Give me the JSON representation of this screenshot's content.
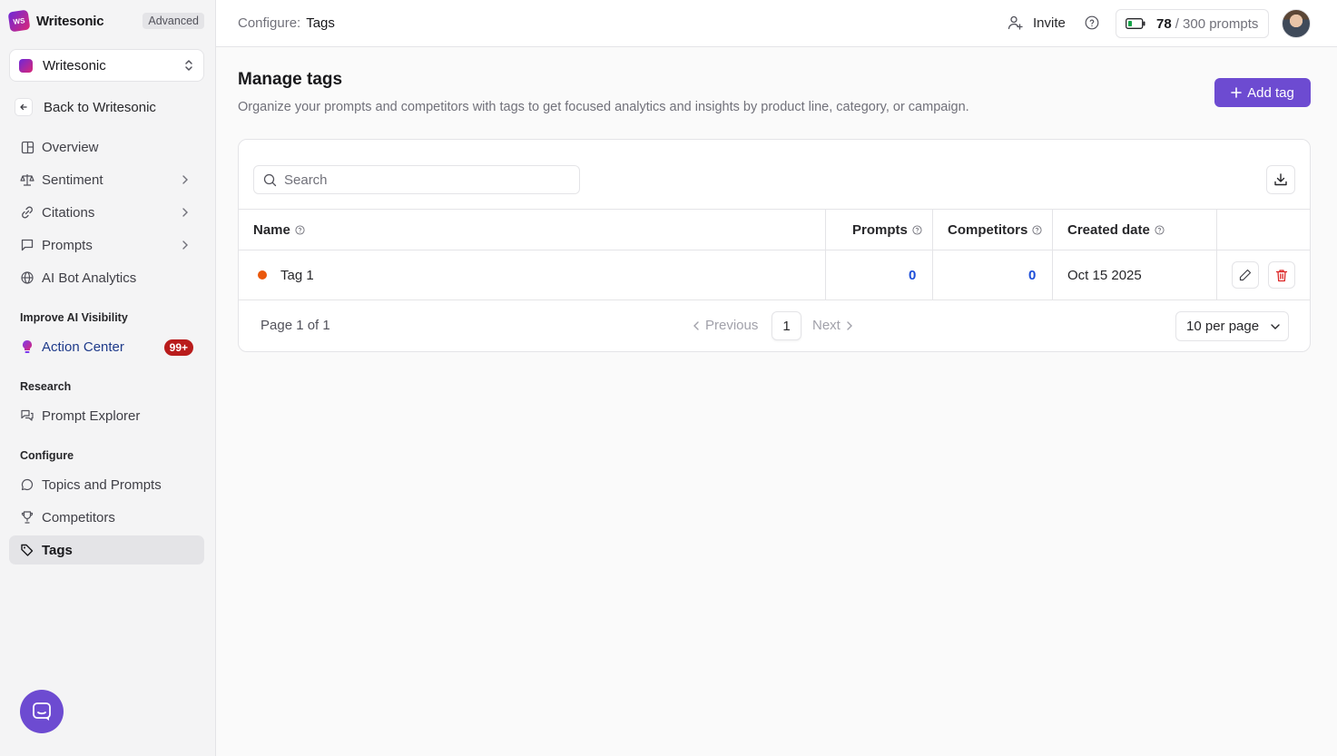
{
  "brand": {
    "logo_text": "WS",
    "name": "Writesonic",
    "plan": "Advanced"
  },
  "workspace": {
    "name": "Writesonic"
  },
  "sidebar": {
    "back_label": "Back to Writesonic",
    "items": [
      {
        "label": "Overview",
        "icon": "layout-icon"
      },
      {
        "label": "Sentiment",
        "icon": "scale-icon"
      },
      {
        "label": "Citations",
        "icon": "link-icon"
      },
      {
        "label": "Prompts",
        "icon": "message-square-icon"
      },
      {
        "label": "AI Bot Analytics",
        "icon": "globe-icon"
      }
    ],
    "improve_heading": "Improve AI Visibility",
    "action_center": {
      "label": "Action Center",
      "badge": "99+"
    },
    "research_heading": "Research",
    "prompt_explorer": "Prompt Explorer",
    "configure_heading": "Configure",
    "configure_items": [
      {
        "label": "Topics and Prompts",
        "icon": "message-circle-icon"
      },
      {
        "label": "Competitors",
        "icon": "trophy-icon"
      },
      {
        "label": "Tags",
        "icon": "tag-icon",
        "active": true
      }
    ]
  },
  "topbar": {
    "breadcrumb_prefix": "Configure:",
    "breadcrumb_current": "Tags",
    "invite_label": "Invite",
    "quota_used": "78",
    "quota_rest": "/ 300 prompts"
  },
  "page": {
    "title": "Manage tags",
    "subtitle": "Organize your prompts and competitors with tags to get focused analytics and insights by product line, category, or campaign.",
    "add_button": "Add tag"
  },
  "table": {
    "search_placeholder": "Search",
    "columns": {
      "name": "Name",
      "prompts": "Prompts",
      "competitors": "Competitors",
      "created": "Created date"
    },
    "rows": [
      {
        "name": "Tag 1",
        "color": "#ea580c",
        "prompts": "0",
        "competitors": "0",
        "created": "Oct 15 2025"
      }
    ],
    "pagination": {
      "info": "Page 1 of 1",
      "previous": "Previous",
      "current_page": "1",
      "next": "Next",
      "per_page": "10 per page"
    }
  },
  "colors": {
    "accent": "#6d4bd1",
    "badge": "#b91c1c",
    "link_number": "#1d4ed8",
    "delete": "#dc2626"
  }
}
